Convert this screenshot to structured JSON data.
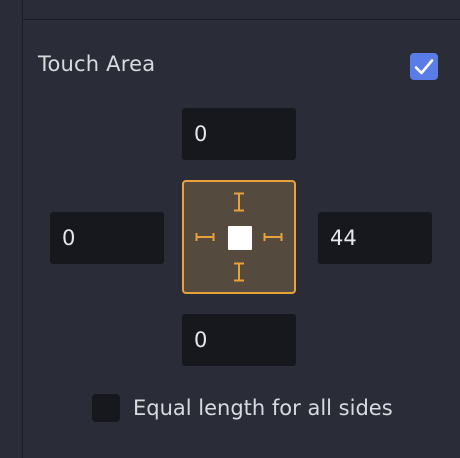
{
  "touch_area": {
    "title": "Touch Area",
    "enabled": true
  },
  "insets": {
    "top": "0",
    "left": "0",
    "right": "44",
    "bottom": "0"
  },
  "equal_sides": {
    "label": "Equal length for all sides",
    "checked": false
  },
  "colors": {
    "accent": "#e8a23c",
    "checkbox_checked": "#5b7ce6"
  }
}
